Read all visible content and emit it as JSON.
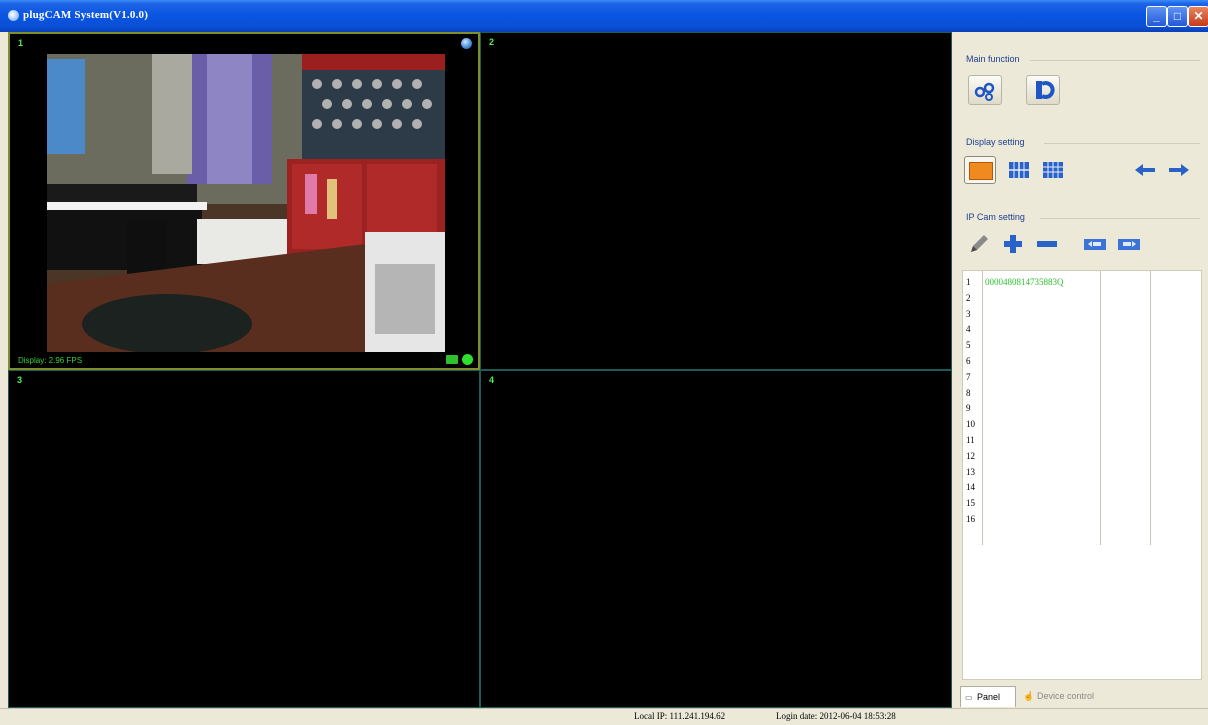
{
  "window": {
    "title": "plugCAM System(V1.0.0)",
    "minimize_label": "_",
    "maximize_label": "□",
    "close_label": "✕"
  },
  "video": {
    "cells": [
      {
        "number": "1",
        "fps": "Display: 2.96 FPS"
      },
      {
        "number": "2"
      },
      {
        "number": "3"
      },
      {
        "number": "4"
      }
    ]
  },
  "panel": {
    "main_function_title": "Main function",
    "display_setting_title": "Display setting",
    "ipcam_setting_title": "IP Cam setting",
    "device_list": [
      {
        "num": "1",
        "id": "0000480814735883Q"
      },
      {
        "num": "2",
        "id": ""
      },
      {
        "num": "3",
        "id": ""
      },
      {
        "num": "4",
        "id": ""
      },
      {
        "num": "5",
        "id": ""
      },
      {
        "num": "6",
        "id": ""
      },
      {
        "num": "7",
        "id": ""
      },
      {
        "num": "8",
        "id": ""
      },
      {
        "num": "9",
        "id": ""
      },
      {
        "num": "10",
        "id": ""
      },
      {
        "num": "11",
        "id": ""
      },
      {
        "num": "12",
        "id": ""
      },
      {
        "num": "13",
        "id": ""
      },
      {
        "num": "14",
        "id": ""
      },
      {
        "num": "15",
        "id": ""
      },
      {
        "num": "16",
        "id": ""
      }
    ],
    "tab_panel": "Panel",
    "tab_device_control": "Device control"
  },
  "status": {
    "local_ip": "Local IP: 111.241.194.62",
    "login_date": "Login date: 2012-06-04 18:53:28"
  },
  "colors": {
    "titlebar": "#0a55e0",
    "video_bg": "#000000",
    "cell_number": "#4ef04e",
    "accent_orange": "#f08a1e",
    "accent_blue": "#2a63c8"
  }
}
